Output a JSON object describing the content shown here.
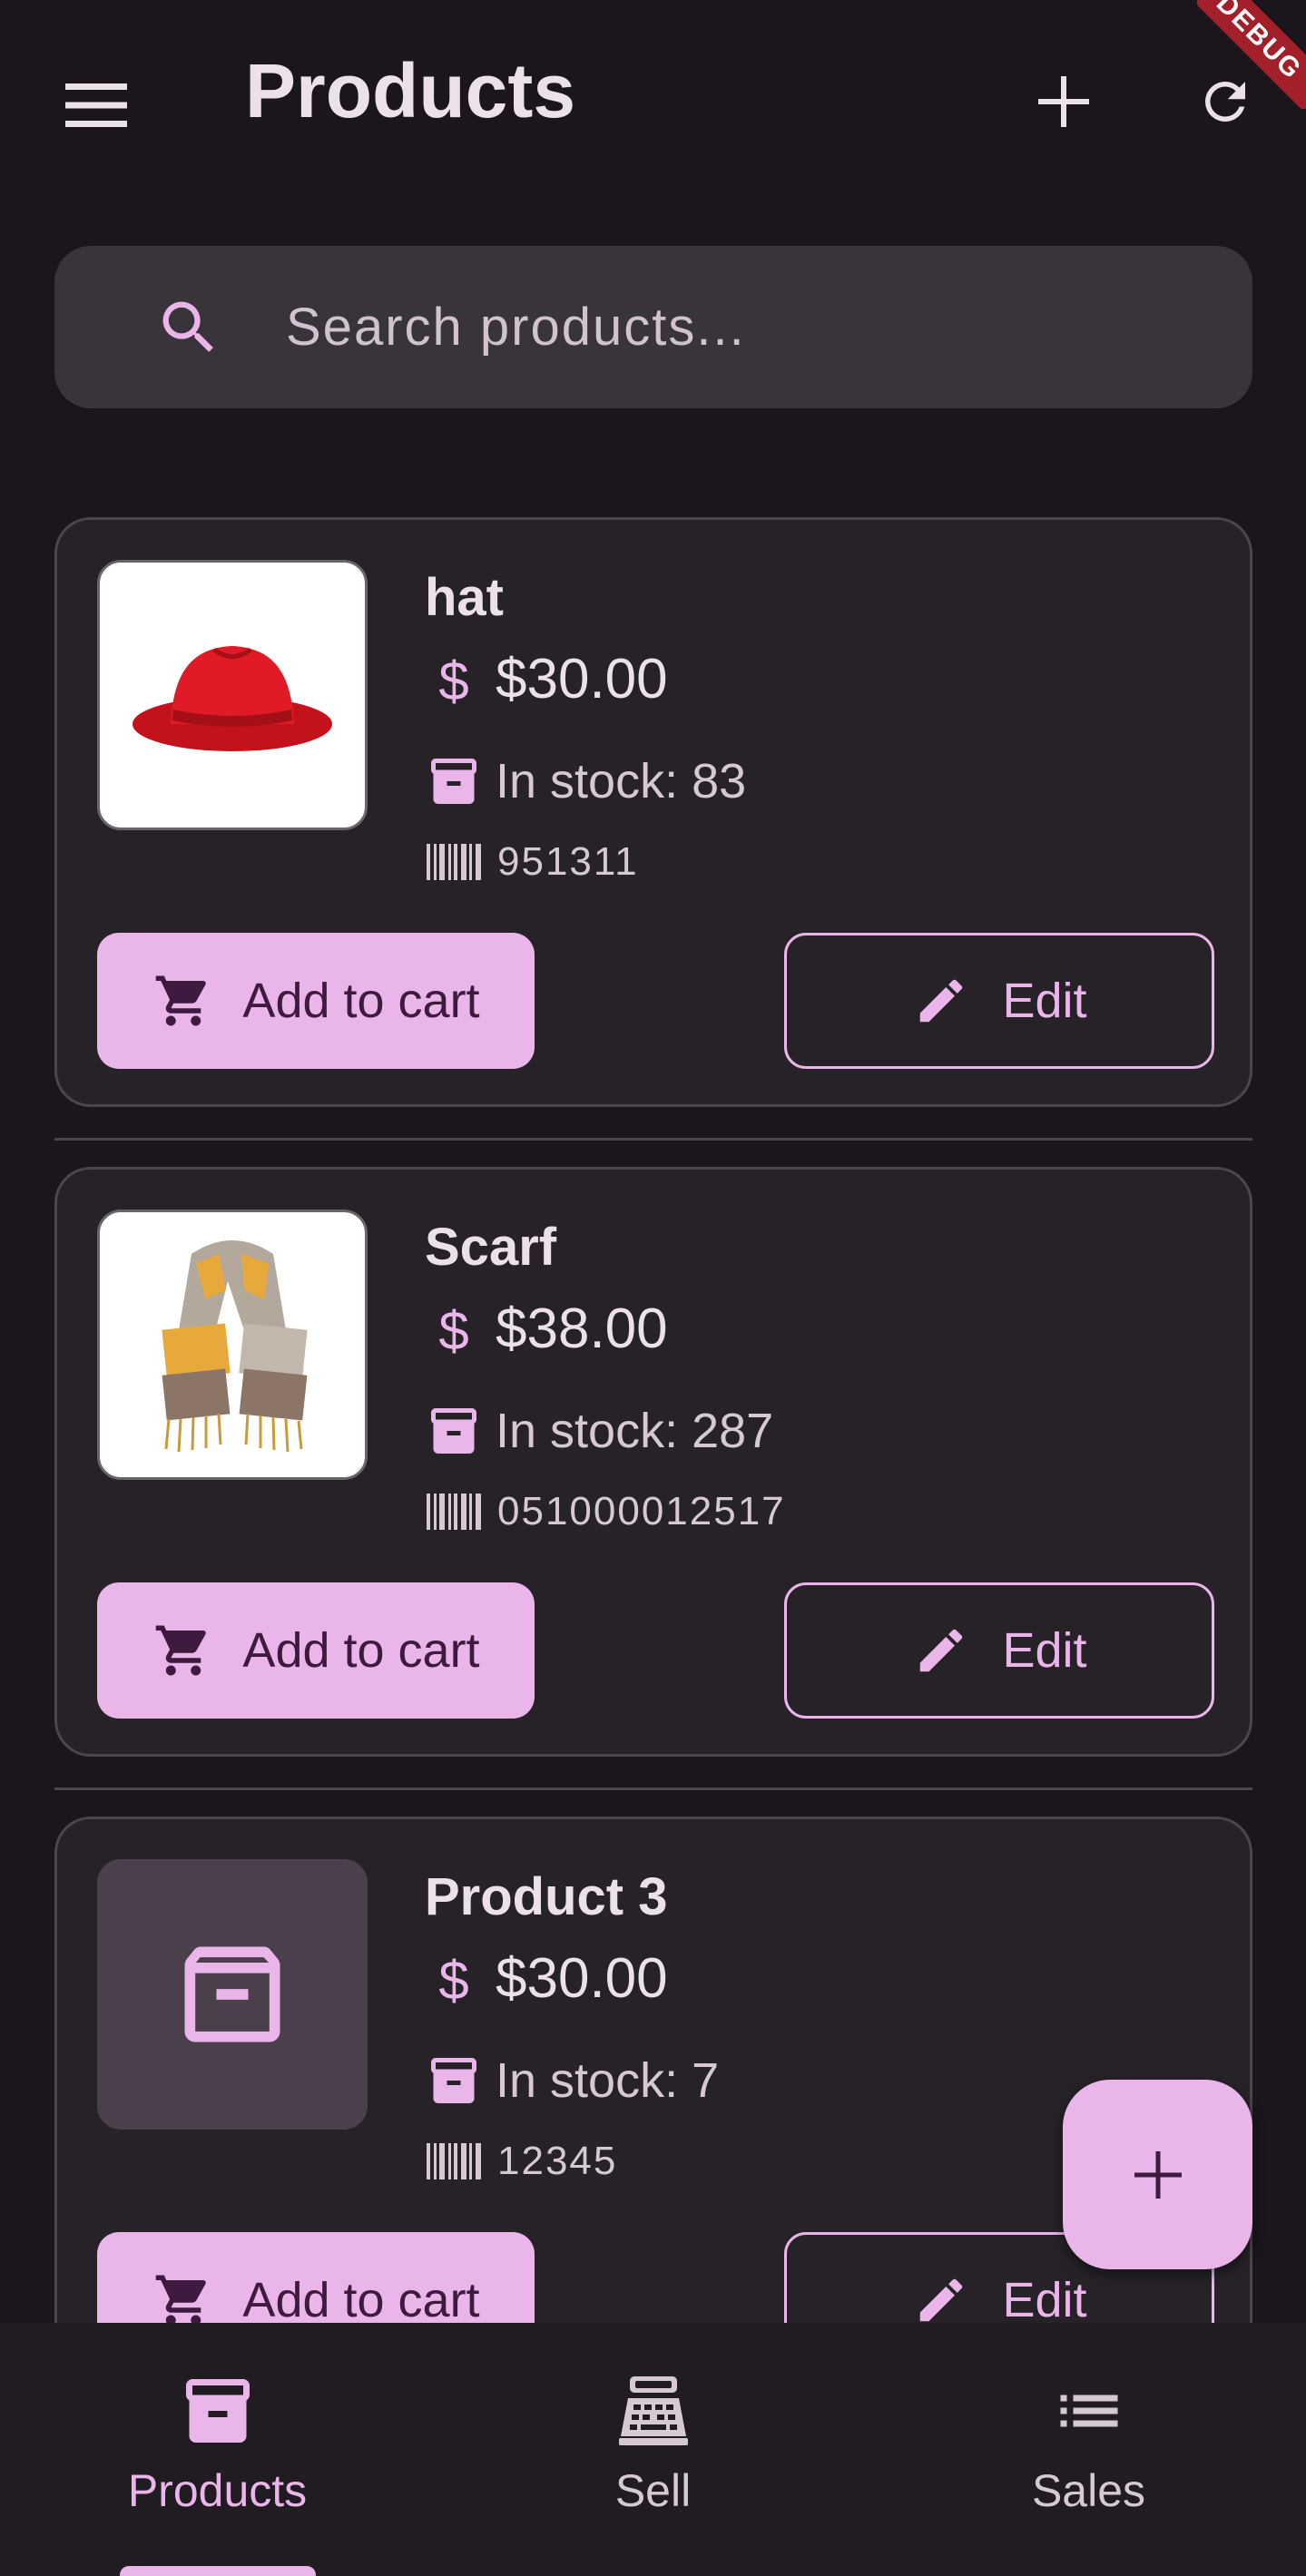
{
  "app": {
    "title": "Products",
    "debug_banner": "DEBUG"
  },
  "appbar": {
    "menu_icon": "menu-icon",
    "add_icon": "add-icon",
    "refresh_icon": "refresh-icon"
  },
  "search": {
    "placeholder": "Search products...",
    "value": "",
    "icon": "search-icon"
  },
  "products": [
    {
      "name": "hat",
      "price": "$30.00",
      "stock": "In stock: 83",
      "barcode": "951311",
      "image": "red-hat-photo",
      "add_label": "Add to cart",
      "edit_label": "Edit"
    },
    {
      "name": "Scarf",
      "price": "$38.00",
      "stock": "In stock: 287",
      "barcode": "051000012517",
      "image": "scarf-photo",
      "add_label": "Add to cart",
      "edit_label": "Edit"
    },
    {
      "name": "Product 3",
      "price": "$30.00",
      "stock": "In stock: 7",
      "barcode": "12345",
      "image": "placeholder-box-icon",
      "add_label": "Add to cart",
      "edit_label": "Edit"
    }
  ],
  "fab": {
    "icon": "add-icon"
  },
  "bottom_nav": {
    "items": [
      {
        "label": "Products",
        "icon": "inventory-icon",
        "active": true
      },
      {
        "label": "Sell",
        "icon": "cash-register-icon",
        "active": false
      },
      {
        "label": "Sales",
        "icon": "list-icon",
        "active": false
      }
    ]
  },
  "colors": {
    "background": "#1a161b",
    "surface": "#262228",
    "accent": "#eab6ea",
    "on_accent": "#3d1a3e",
    "search_bg": "#39333b",
    "debug_red": "#a3202a"
  }
}
